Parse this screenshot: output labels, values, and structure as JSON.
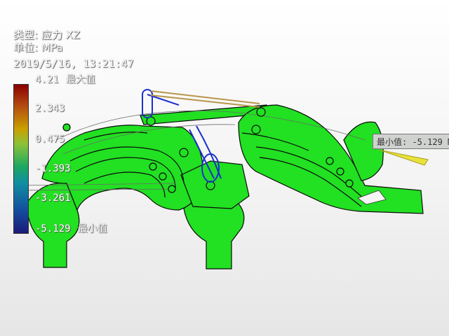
{
  "header": {
    "type_line": "类型: 应力 XZ",
    "unit_line": "单位: MPa",
    "timestamp": "2019/5/16, 13:21:47"
  },
  "legend": {
    "ticks": [
      "4.21",
      "2.343",
      "0.475",
      "-1.393",
      "-3.261",
      "-5.129"
    ],
    "max_tag": "最大值",
    "min_tag": "最小值"
  },
  "probe": {
    "min_label": "最小值: -5.129 M"
  },
  "colors": {
    "part_fill": "#22e022",
    "edge": "#0a0a0a",
    "link_blue": "#1a2fd0",
    "link_tan": "#b8964a",
    "probe_yellow": "#e8e23a"
  },
  "icons": [
    "stress-plot-model",
    "min-value-probe"
  ]
}
